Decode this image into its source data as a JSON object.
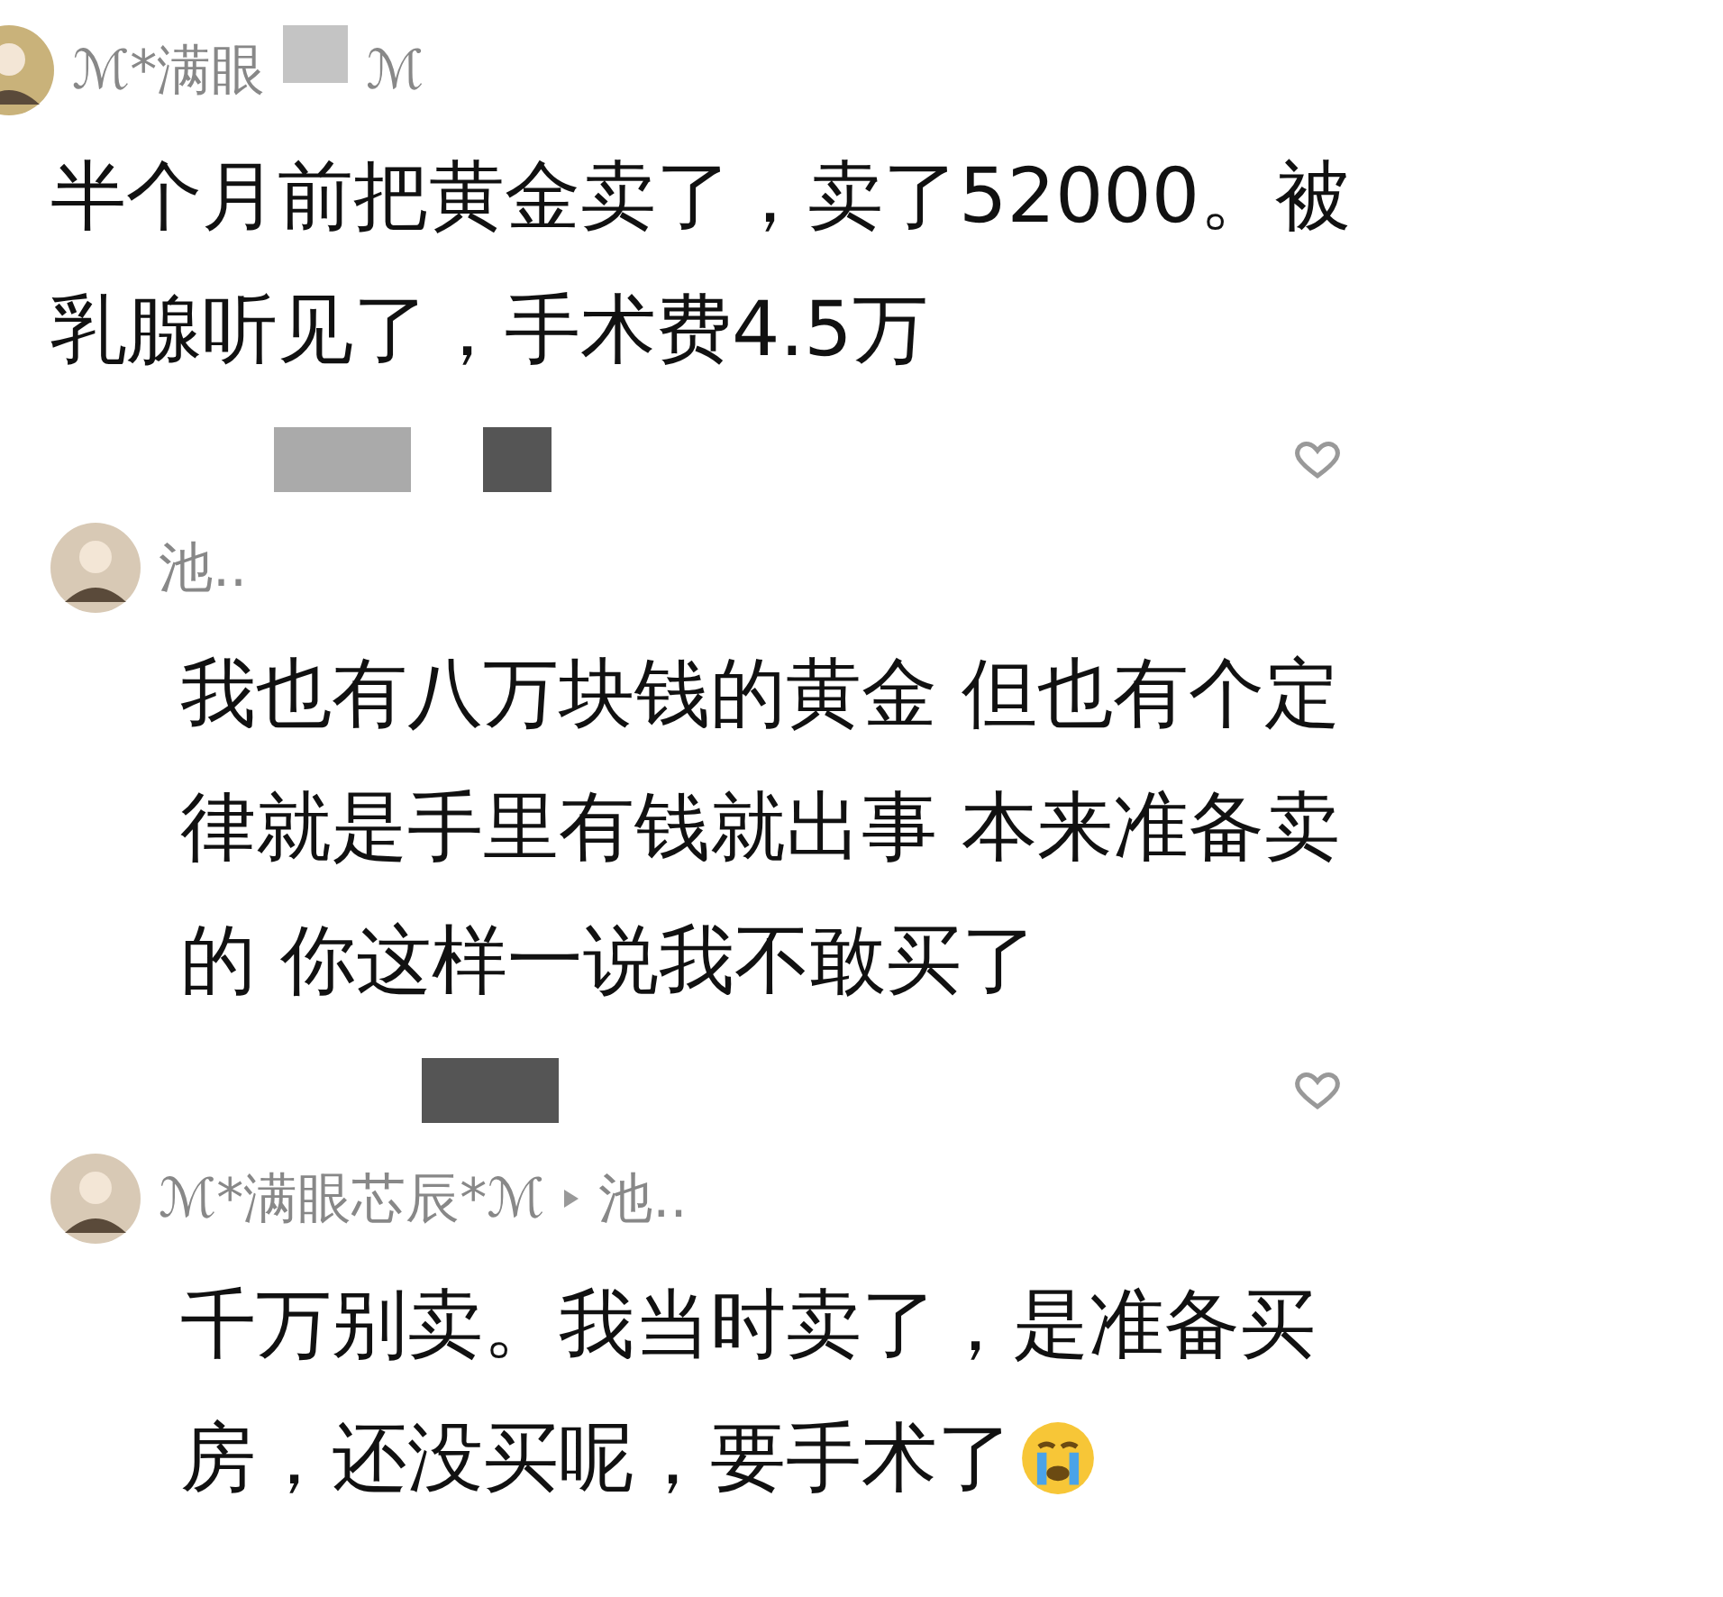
{
  "comments": [
    {
      "kind": "top",
      "name": "ℳ*满眼",
      "name_suffix": "ℳ",
      "lines": [
        "半个月前把黄金卖了，卖了52000。被",
        "乳腺听见了，手术费4.5万"
      ],
      "liked": false
    },
    {
      "kind": "reply",
      "name": "池..",
      "lines": [
        "我也有八万块钱的黄金 但也有个定",
        "律就是手里有钱就出事  本来准备卖",
        "的  你这样一说我不敢买了"
      ],
      "liked": false
    },
    {
      "kind": "reply",
      "name": "ℳ*满眼芯辰*ℳ",
      "reply_to": "池..",
      "lines": [
        "千万别卖。我当时卖了，是准备买",
        "房，还没买呢，要手术了"
      ],
      "emoji": true
    }
  ]
}
